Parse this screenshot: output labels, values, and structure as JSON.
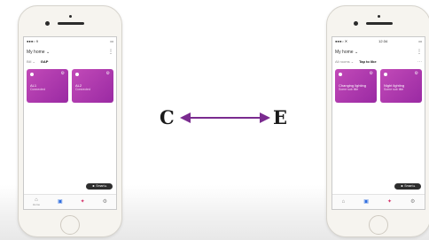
{
  "colors": {
    "card_purple": "#b03aab",
    "arrow_purple": "#7a2b8f",
    "tab_active": "#2f6ee0"
  },
  "labels": {
    "left": "C",
    "right": "E"
  },
  "left_phone": {
    "status": {
      "carrier": "●●●○ 9",
      "time": "",
      "battery": "▭"
    },
    "header": {
      "title": "My home ⌄",
      "more": "⋮"
    },
    "sub_header": {
      "link": "Bill ⌄",
      "value": "GAP",
      "more": ""
    },
    "cards": [
      {
        "title": "AL1",
        "subtitle": "Connected"
      },
      {
        "title": "AL2",
        "subtitle": "Connected"
      }
    ],
    "fab_label": "☻ Smart ▸",
    "tabs": [
      {
        "icon": "home-icon",
        "glyph": "⌂",
        "label": "Home"
      },
      {
        "icon": "devices-icon",
        "glyph": "▣",
        "label": ""
      },
      {
        "icon": "scenes-icon",
        "glyph": "✦",
        "label": ""
      },
      {
        "icon": "settings-icon",
        "glyph": "⚙",
        "label": ""
      }
    ]
  },
  "right_phone": {
    "status": {
      "carrier": "●●●○ ✕",
      "time": "12:34",
      "battery": "▭"
    },
    "header": {
      "title": "My home ⌄",
      "more": "⋮"
    },
    "sub_header": {
      "link": "All rooms ⌄",
      "value": "Tap to like",
      "more": "···"
    },
    "cards": [
      {
        "title": "Changing lighting",
        "subtitle": "Some sub title"
      },
      {
        "title": "Night lighting",
        "subtitle": "Some sub title"
      }
    ],
    "fab_label": "☻ Smart ▸",
    "tabs": [
      {
        "icon": "home-icon",
        "glyph": "⌂",
        "label": ""
      },
      {
        "icon": "devices-icon",
        "glyph": "▣",
        "label": ""
      },
      {
        "icon": "scenes-icon",
        "glyph": "✦",
        "label": ""
      },
      {
        "icon": "settings-icon",
        "glyph": "⚙",
        "label": ""
      }
    ]
  }
}
